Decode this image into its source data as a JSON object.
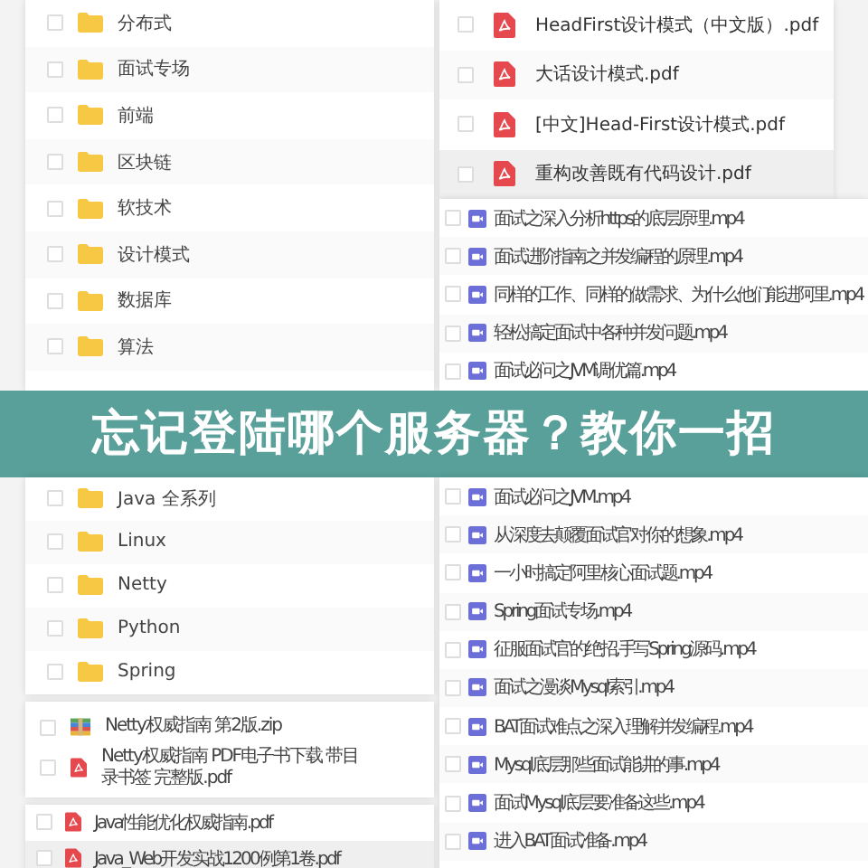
{
  "folders": {
    "above": [
      {
        "name": "分布式",
        "checked": false
      },
      {
        "name": "面试专场",
        "checked": false
      },
      {
        "name": "前端",
        "checked": false
      },
      {
        "name": "区块链",
        "checked": false
      },
      {
        "name": "软技术",
        "checked": false
      },
      {
        "name": "设计模式",
        "checked": false
      },
      {
        "name": "数据库",
        "checked": false
      },
      {
        "name": "算法",
        "checked": false
      }
    ],
    "below": [
      {
        "name": "Java 全系列",
        "checked": false
      },
      {
        "name": "Linux",
        "checked": false
      },
      {
        "name": "Netty",
        "checked": false
      },
      {
        "name": "Python",
        "checked": false
      },
      {
        "name": "Spring",
        "checked": false
      }
    ]
  },
  "downloads": {
    "items": [
      {
        "name": "Netty权威指南 第2版.zip",
        "kind": "zip",
        "checked": false
      },
      {
        "name": "Netty权威指南 PDF电子书下载 带目录书签 完整版.pdf",
        "kind": "pdf",
        "checked": false
      }
    ]
  },
  "ebooks": {
    "items": [
      {
        "name": "Java性能优化权威指南.pdf",
        "checked": false,
        "selected": false
      },
      {
        "name": "Java_Web开发实战1200例第1卷.pdf",
        "checked": false,
        "selected": true
      }
    ]
  },
  "pdf_files": {
    "items": [
      {
        "name": "HeadFirst设计模式（中文版）.pdf",
        "checked": false,
        "selected": false
      },
      {
        "name": "大话设计模式.pdf",
        "checked": false,
        "selected": false
      },
      {
        "name": "[中文]Head-First设计模式.pdf",
        "checked": false,
        "selected": false
      },
      {
        "name": "重构改善既有代码设计.pdf",
        "checked": false,
        "selected": true
      }
    ]
  },
  "video_files": {
    "above": [
      {
        "name": "面试之深入分析https的底层原理.mp4",
        "checked": false
      },
      {
        "name": "面试进阶指南之并发编程的原理.mp4",
        "checked": false
      },
      {
        "name": "同样的工作、同样的做需求、为什么他们能进阿里.mp4",
        "checked": false
      },
      {
        "name": "轻松搞定面试中各种并发问题.mp4",
        "checked": false
      },
      {
        "name": "面试必问之JVM调优篇.mp4",
        "checked": false
      }
    ],
    "below": [
      {
        "name": "面试必问之JVM.mp4",
        "checked": false
      },
      {
        "name": "从深度去颠覆面试官对你的想象.mp4",
        "checked": false
      },
      {
        "name": "一小时搞定阿里核心面试题.mp4",
        "checked": false
      },
      {
        "name": "Spring面试专场.mp4",
        "checked": false
      },
      {
        "name": "征服面试官的绝招,手写Spring源码.mp4",
        "checked": false
      },
      {
        "name": "面试之漫谈Mysql索引.mp4",
        "checked": false
      },
      {
        "name": "BAT面试难点之深入理解并发编程.mp4",
        "checked": false
      },
      {
        "name": "Mysql底层那些面试能讲的事.mp4",
        "checked": false
      },
      {
        "name": "面试Mysql底层要准备这些.mp4",
        "checked": false
      },
      {
        "name": "进入BAT面试准备.mp4",
        "checked": false
      }
    ]
  },
  "banner": {
    "title": "忘记登陆哪个服务器？教你一招"
  }
}
